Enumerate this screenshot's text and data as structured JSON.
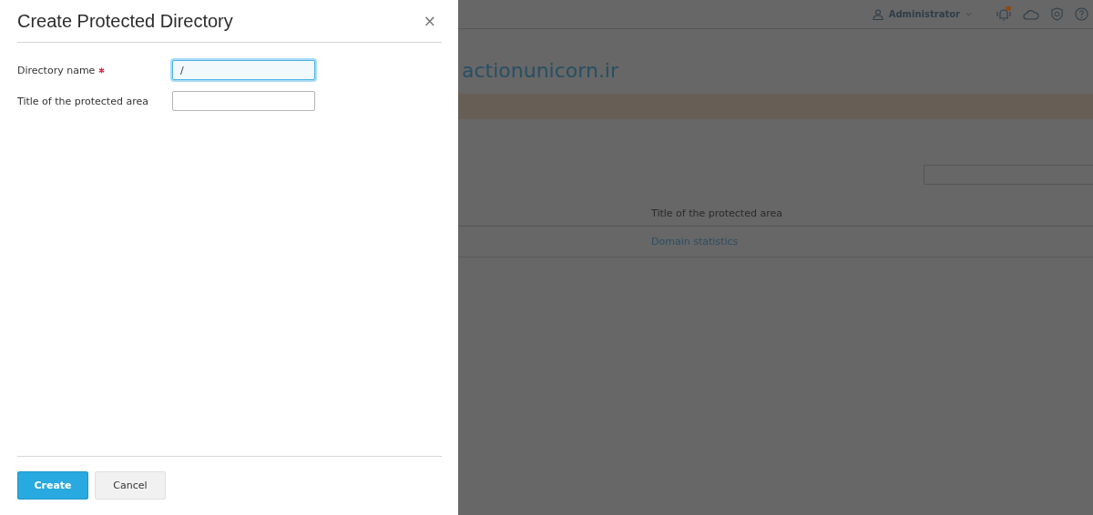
{
  "dialog": {
    "title": "Create Protected Directory",
    "close": "×",
    "fields": [
      {
        "label": "Directory name",
        "required": true,
        "value": "/",
        "focused": true
      },
      {
        "label": "Title of the protected area",
        "required": false,
        "focused": false
      }
    ],
    "buttons": [
      {
        "label": "Create",
        "kind": "primary"
      },
      {
        "label": "Cancel",
        "kind": "secondary"
      }
    ]
  },
  "background": {
    "user_menu": "Administrator",
    "page_title": "actionunicorn.ir",
    "table": {
      "columns": [
        "Title of the protected area"
      ],
      "rows": [
        [
          "Domain statistics"
        ]
      ]
    }
  }
}
